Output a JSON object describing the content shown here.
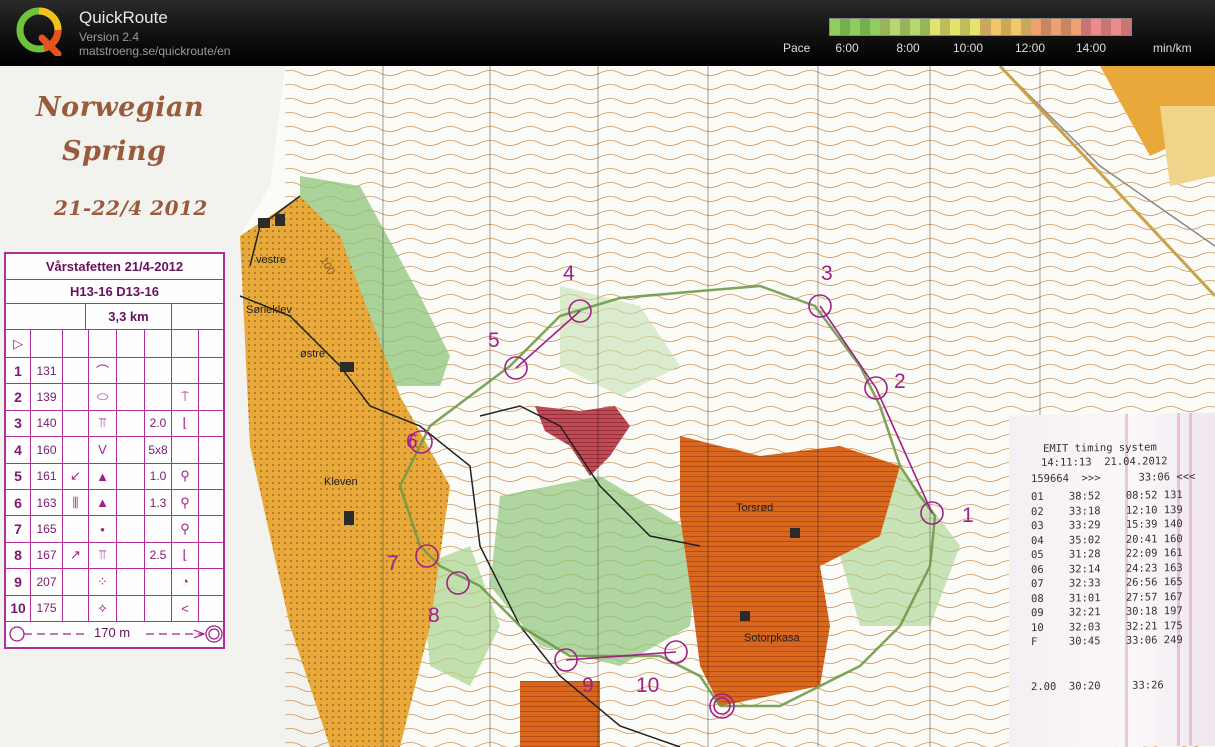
{
  "header": {
    "app_name": "QuickRoute",
    "version": "Version 2.4",
    "url": "matstroeng.se/quickroute/en",
    "pace": {
      "label": "Pace",
      "ticks": [
        "6:00",
        "8:00",
        "10:00",
        "12:00",
        "14:00"
      ],
      "unit": "min/km",
      "colors": [
        "#8fce5e",
        "#b6d86a",
        "#e2e46c",
        "#f0c86a",
        "#f0a070",
        "#ee8a8a"
      ]
    }
  },
  "map": {
    "event": {
      "line1": "Norwegian",
      "line2": "Spring",
      "date": "21-22/4 2012"
    },
    "control_description": {
      "event": "Vårstafetten 21/4-2012",
      "classes": "H13-16 D13-16",
      "length": "3,3 km",
      "controls": [
        {
          "num": "1",
          "code": "131",
          "sym1": "",
          "sym2": "⌒",
          "size": "",
          "extra": ""
        },
        {
          "num": "2",
          "code": "139",
          "sym1": "",
          "sym2": "⬭",
          "size": "",
          "extra": "⍑"
        },
        {
          "num": "3",
          "code": "140",
          "sym1": "",
          "sym2": "⫪",
          "size": "2.0",
          "extra": "⌊"
        },
        {
          "num": "4",
          "code": "160",
          "sym1": "",
          "sym2": "V",
          "size": "5x8",
          "extra": ""
        },
        {
          "num": "5",
          "code": "161",
          "sym1": "↙",
          "sym2": "▲",
          "size": "1.0",
          "extra": "⚲"
        },
        {
          "num": "6",
          "code": "163",
          "sym1": "⫼",
          "sym2": "▲",
          "size": "1.3",
          "extra": "⚲"
        },
        {
          "num": "7",
          "code": "165",
          "sym1": "",
          "sym2": "•",
          "size": "",
          "extra": "⚲"
        },
        {
          "num": "8",
          "code": "167",
          "sym1": "↗",
          "sym2": "⫪",
          "size": "2.5",
          "extra": "⌊"
        },
        {
          "num": "9",
          "code": "207",
          "sym1": "",
          "sym2": "⁘",
          "size": "",
          "extra": "◔"
        },
        {
          "num": "10",
          "code": "175",
          "sym1": "",
          "sym2": "⟡",
          "size": "",
          "extra": "<"
        }
      ],
      "finish_distance": "170 m"
    },
    "place_names": {
      "vestre": "vestre",
      "sorleklev": "Sørleklev",
      "ostre": "østre",
      "kleven": "Kleven",
      "torsrod": "Torsrød",
      "sotorpkasa": "Sotorpkasa",
      "contour": "100"
    },
    "control_numbers": [
      "1",
      "2",
      "3",
      "4",
      "5",
      "6",
      "7",
      "8",
      "9",
      "10"
    ],
    "receipt": {
      "title": "EMIT timing system",
      "time_date": "14:11:13  21.04.2012",
      "header": "159664  >>>      33:06 <<<",
      "splits": [
        "01    38:52    08:52 131",
        "02    33:18    12:10 139",
        "03    33:29    15:39 140",
        "04    35:02    20:41 160",
        "05    31:28    22:09 161",
        "06    32:14    24:23 163",
        "07    32:33    26:56 165",
        "08    31:01    27:57 167",
        "09    32:21    30:18 197",
        "10    32:03    32:21 175",
        "F     30:45    33:06 249"
      ],
      "footer": "2.00  30:20     33:26"
    }
  }
}
